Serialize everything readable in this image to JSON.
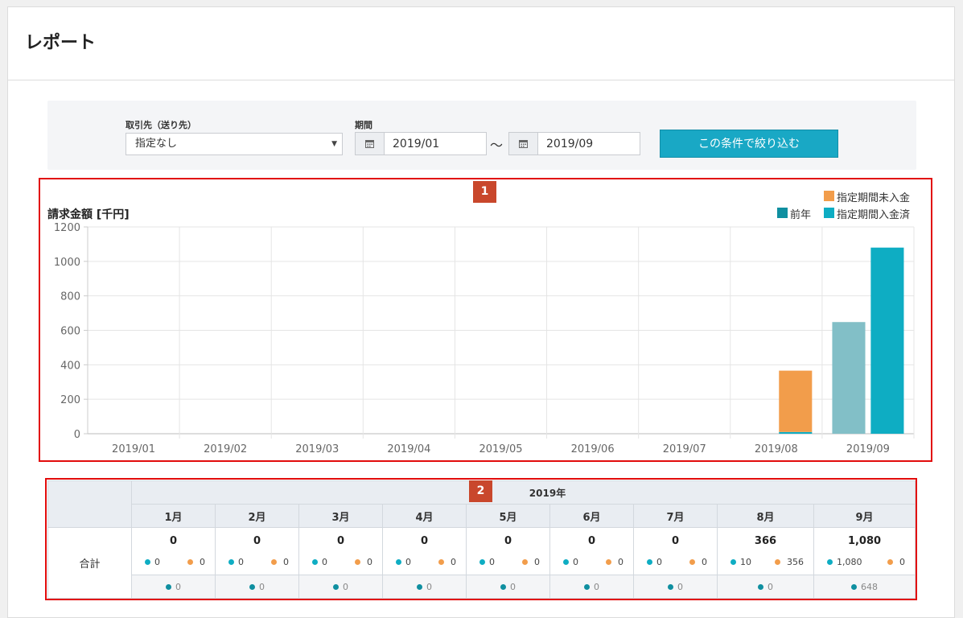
{
  "page": {
    "title": "レポート"
  },
  "filters": {
    "customer_label": "取引先（送り先）",
    "customer_value": "指定なし",
    "period_label": "期間",
    "date_from": "2019/01",
    "date_to": "2019/09",
    "separator": "～",
    "apply_label": "この条件で絞り込む"
  },
  "annotations": {
    "marker1": "1",
    "marker2": "2"
  },
  "colors": {
    "unpaid": "#f29d4b",
    "paid": "#0eadc3",
    "prev_year": "#0f8fa0",
    "prev_year_bar": "#82bfc7"
  },
  "chart_data": {
    "type": "bar",
    "title": "請求金額 [千円]",
    "categories": [
      "2019/01",
      "2019/02",
      "2019/03",
      "2019/04",
      "2019/05",
      "2019/06",
      "2019/07",
      "2019/08",
      "2019/09"
    ],
    "series": [
      {
        "name": "前年",
        "values": [
          0,
          0,
          0,
          0,
          0,
          0,
          0,
          0,
          648
        ]
      },
      {
        "name": "指定期間入金済",
        "values": [
          0,
          0,
          0,
          0,
          0,
          0,
          0,
          10,
          1080
        ]
      },
      {
        "name": "指定期間未入金",
        "values": [
          0,
          0,
          0,
          0,
          0,
          0,
          0,
          356,
          0
        ]
      }
    ],
    "stacked": [
      "指定期間入金済",
      "指定期間未入金"
    ],
    "yticks": [
      "0",
      "200",
      "400",
      "600",
      "800",
      "1000",
      "1200"
    ],
    "ylim": [
      0,
      1200
    ],
    "grid": true,
    "legend": "top-right"
  },
  "table": {
    "year_label": "2019年",
    "row_label": "合計",
    "months": [
      {
        "label": "1月",
        "total": "0",
        "paid": "0",
        "unpaid": "0",
        "prev": "0"
      },
      {
        "label": "2月",
        "total": "0",
        "paid": "0",
        "unpaid": "0",
        "prev": "0"
      },
      {
        "label": "3月",
        "total": "0",
        "paid": "0",
        "unpaid": "0",
        "prev": "0"
      },
      {
        "label": "4月",
        "total": "0",
        "paid": "0",
        "unpaid": "0",
        "prev": "0"
      },
      {
        "label": "5月",
        "total": "0",
        "paid": "0",
        "unpaid": "0",
        "prev": "0"
      },
      {
        "label": "6月",
        "total": "0",
        "paid": "0",
        "unpaid": "0",
        "prev": "0"
      },
      {
        "label": "7月",
        "total": "0",
        "paid": "0",
        "unpaid": "0",
        "prev": "0"
      },
      {
        "label": "8月",
        "total": "366",
        "paid": "10",
        "unpaid": "356",
        "prev": "0"
      },
      {
        "label": "9月",
        "total": "1,080",
        "paid": "1,080",
        "unpaid": "0",
        "prev": "648"
      }
    ]
  }
}
